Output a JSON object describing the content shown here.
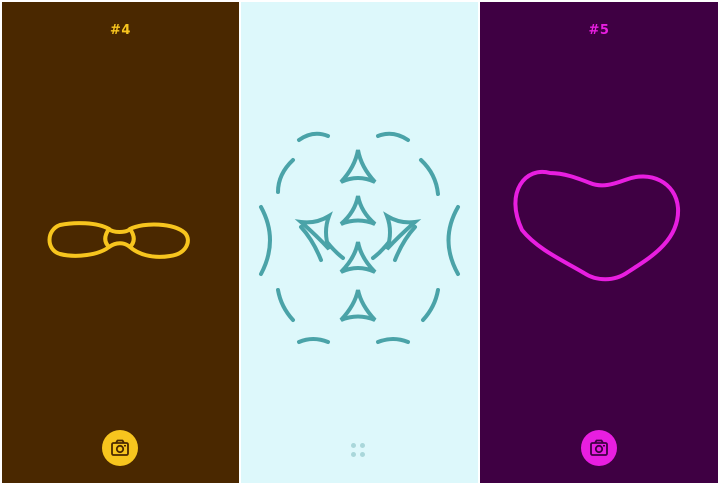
{
  "screens": [
    {
      "id": "left",
      "level_label": "#4",
      "background": "#4A2800",
      "accent": "#F7C51E",
      "shape_icon": "double-loop-shape",
      "action_icon": "camera-icon"
    },
    {
      "id": "middle",
      "background": "#DDF8FB",
      "accent": "#4AA3A8",
      "dots_color": "#A9D7DA",
      "shape_icon": "kaleidoscope-pattern",
      "action_icon": "grid-dots-icon"
    },
    {
      "id": "right",
      "level_label": "#5",
      "background": "#3F0043",
      "accent": "#E81EE0",
      "shape_icon": "heart-blob-shape",
      "action_icon": "camera-icon"
    }
  ]
}
